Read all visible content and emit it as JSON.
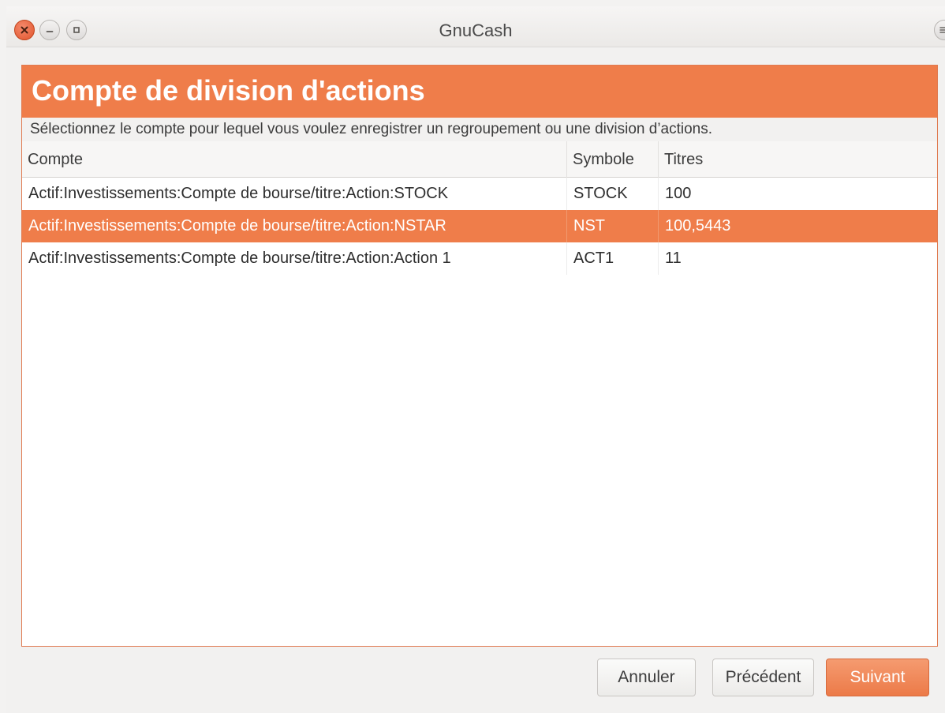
{
  "window": {
    "title": "GnuCash"
  },
  "page": {
    "heading": "Compte de division d'actions",
    "description": "Sélectionnez le compte pour lequel vous voulez enregistrer un regroupement ou une division d’actions."
  },
  "table": {
    "columns": [
      "Compte",
      "Symbole",
      "Titres"
    ],
    "rows": [
      {
        "account": "Actif:Investissements:Compte de bourse/titre:Action:STOCK",
        "symbol": "STOCK",
        "shares": "100",
        "selected": false
      },
      {
        "account": "Actif:Investissements:Compte de bourse/titre:Action:NSTAR",
        "symbol": "NST",
        "shares": "100,5443",
        "selected": true
      },
      {
        "account": "Actif:Investissements:Compte de bourse/titre:Action:Action 1",
        "symbol": "ACT1",
        "shares": "11",
        "selected": false
      }
    ]
  },
  "buttons": {
    "cancel": "Annuler",
    "previous": "Précédent",
    "next": "Suivant"
  },
  "colors": {
    "accent": "#ef7d4a",
    "close": "#e0542c"
  },
  "icons": [
    "close-icon",
    "minimize-icon",
    "maximize-icon",
    "menu-icon"
  ]
}
